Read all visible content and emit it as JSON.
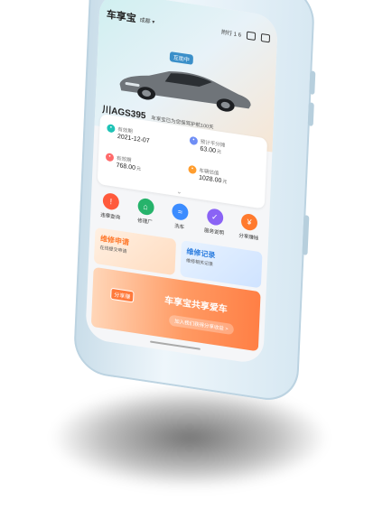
{
  "header": {
    "brand": "车享宝",
    "city": "成都",
    "status_right": "附行 1 6"
  },
  "hero": {
    "badge": "互助中",
    "plate": "川AGS395",
    "note": "车享宝已为您保驾护航100天"
  },
  "info": [
    {
      "label": "有效期",
      "value": "2021-12-07",
      "unit": "",
      "color": "#1fc3b6"
    },
    {
      "label": "预计平分摊",
      "value": "63.00",
      "unit": "元",
      "color": "#6f8ef5"
    },
    {
      "label": "有效期",
      "value": "768.00",
      "unit": "元",
      "color": "#ff6a6a"
    },
    {
      "label": "车辆估值",
      "value": "1028.00",
      "unit": "元",
      "color": "#ff9d2e"
    }
  ],
  "quick": [
    {
      "label": "违章查询",
      "color": "#ff5a3c"
    },
    {
      "label": "修理厂",
      "color": "#26b36b"
    },
    {
      "label": "洗车",
      "color": "#3c8cff"
    },
    {
      "label": "服务说明",
      "color": "#8a63f5"
    },
    {
      "label": "分享赚钱",
      "color": "#ff7a2e"
    }
  ],
  "cards": {
    "repair_title": "维修申请",
    "repair_sub": "在线提交申请",
    "record_title": "维修记录",
    "record_sub": "维修相关记录"
  },
  "banner": {
    "tag": "分享赚",
    "title": "车享宝共享爱车",
    "button": "加入我们获得分享收益 >"
  }
}
